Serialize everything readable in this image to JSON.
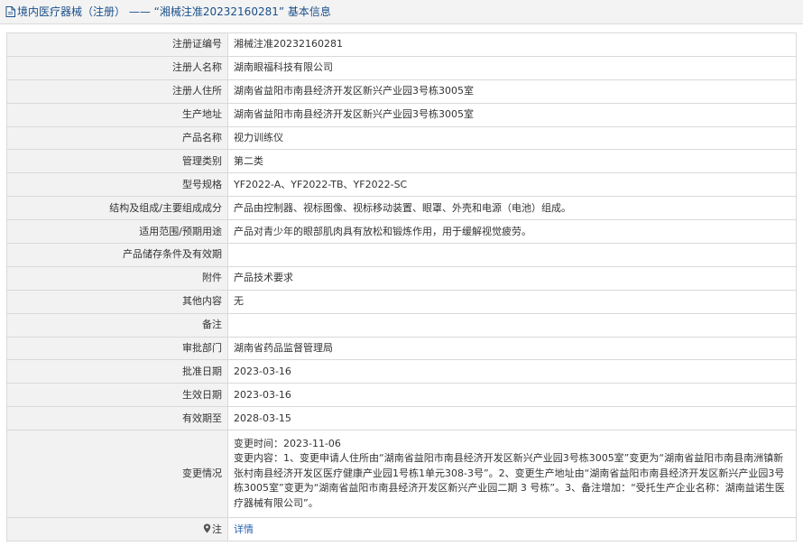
{
  "header": {
    "category": "境内医疗器械（注册）",
    "separator": " —— ",
    "reg_no_quoted": "“湘械注准20232160281”",
    "suffix": " 基本信息"
  },
  "rows": [
    {
      "label": "注册证编号",
      "value": "湘械注准20232160281"
    },
    {
      "label": "注册人名称",
      "value": "湖南眼福科技有限公司"
    },
    {
      "label": "注册人住所",
      "value": "湖南省益阳市南县经济开发区新兴产业园3号栋3005室"
    },
    {
      "label": "生产地址",
      "value": "湖南省益阳市南县经济开发区新兴产业园3号栋3005室"
    },
    {
      "label": "产品名称",
      "value": "视力训练仪"
    },
    {
      "label": "管理类别",
      "value": "第二类"
    },
    {
      "label": "型号规格",
      "value": "YF2022-A、YF2022-TB、YF2022-SC"
    },
    {
      "label": "结构及组成/主要组成成分",
      "value": "产品由控制器、视标图像、视标移动装置、眼罩、外壳和电源（电池）组成。"
    },
    {
      "label": "适用范围/预期用途",
      "value": "产品对青少年的眼部肌肉具有放松和锻炼作用，用于缓解视觉疲劳。"
    },
    {
      "label": "产品储存条件及有效期",
      "value": ""
    },
    {
      "label": "附件",
      "value": "产品技术要求"
    },
    {
      "label": "其他内容",
      "value": "无"
    },
    {
      "label": "备注",
      "value": ""
    },
    {
      "label": "审批部门",
      "value": "湖南省药品监督管理局"
    },
    {
      "label": "批准日期",
      "value": "2023-03-16"
    },
    {
      "label": "生效日期",
      "value": "2023-03-16"
    },
    {
      "label": "有效期至",
      "value": "2028-03-15"
    }
  ],
  "change": {
    "label": "变更情况",
    "time": "变更时间：2023-11-06",
    "content": "变更内容：1、变更申请人住所由“湖南省益阳市南县经济开发区新兴产业园3号栋3005室”变更为“湖南省益阳市南县南洲镇新张村南县经济开发区医疗健康产业园1号栋1单元308-3号”。2、变更生产地址由“湖南省益阳市南县经济开发区新兴产业园3号栋3005室”变更为“湖南省益阳市南县经济开发区新兴产业园二期 3 号栋”。3、备注增加：“受托生产企业名称：湖南益诺生医疗器械有限公司”。"
  },
  "note": {
    "label": "注",
    "link": "详情"
  },
  "colors": {
    "title_text": "#1a4f8a",
    "label_bg": "#f2f2f2",
    "border": "#d9d9d9",
    "link": "#2a62b0"
  }
}
